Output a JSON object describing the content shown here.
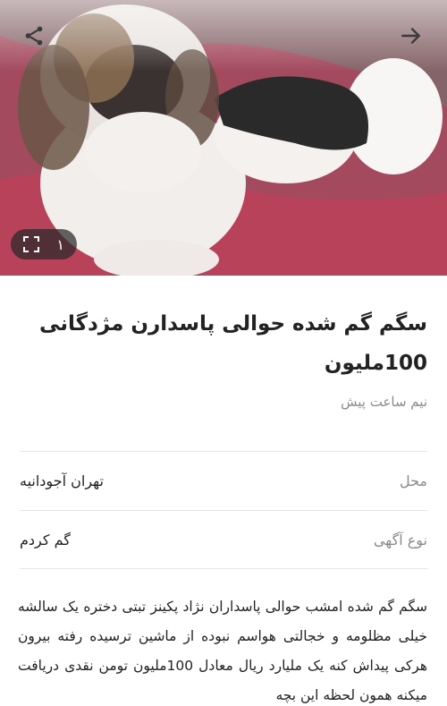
{
  "header": {
    "share_icon": "share-icon",
    "back_icon": "arrow-right-icon"
  },
  "gallery": {
    "image_count": "۱",
    "fullscreen_icon": "fullscreen-icon",
    "image_alt": "dog photo"
  },
  "listing": {
    "title": "سگم گم شده حوالی پاسدارن مژدگانی 100ملیون",
    "time": "نیم ساعت پیش",
    "details": [
      {
        "label": "محل",
        "value": "تهران آجودانیه"
      },
      {
        "label": "نوع آگهی",
        "value": "گم کردم"
      }
    ],
    "description": "سگم گم شده امشب حوالی پاسداران نژاد پکینز تبتی دختره یک سالشه خیلی مظلومه و خجالتی هواسم نبوده از ماشین ترسیده رفته بیرون هرکی پیداش کنه یک ملیارد ریال معادل 100ملیون تومن نقدی دریافت میکنه همون لحظه این بچه"
  },
  "colors": {
    "text_primary": "#222222",
    "text_secondary": "#8a8a8a",
    "divider": "#e6e6e6",
    "pill_bg": "#282828"
  }
}
